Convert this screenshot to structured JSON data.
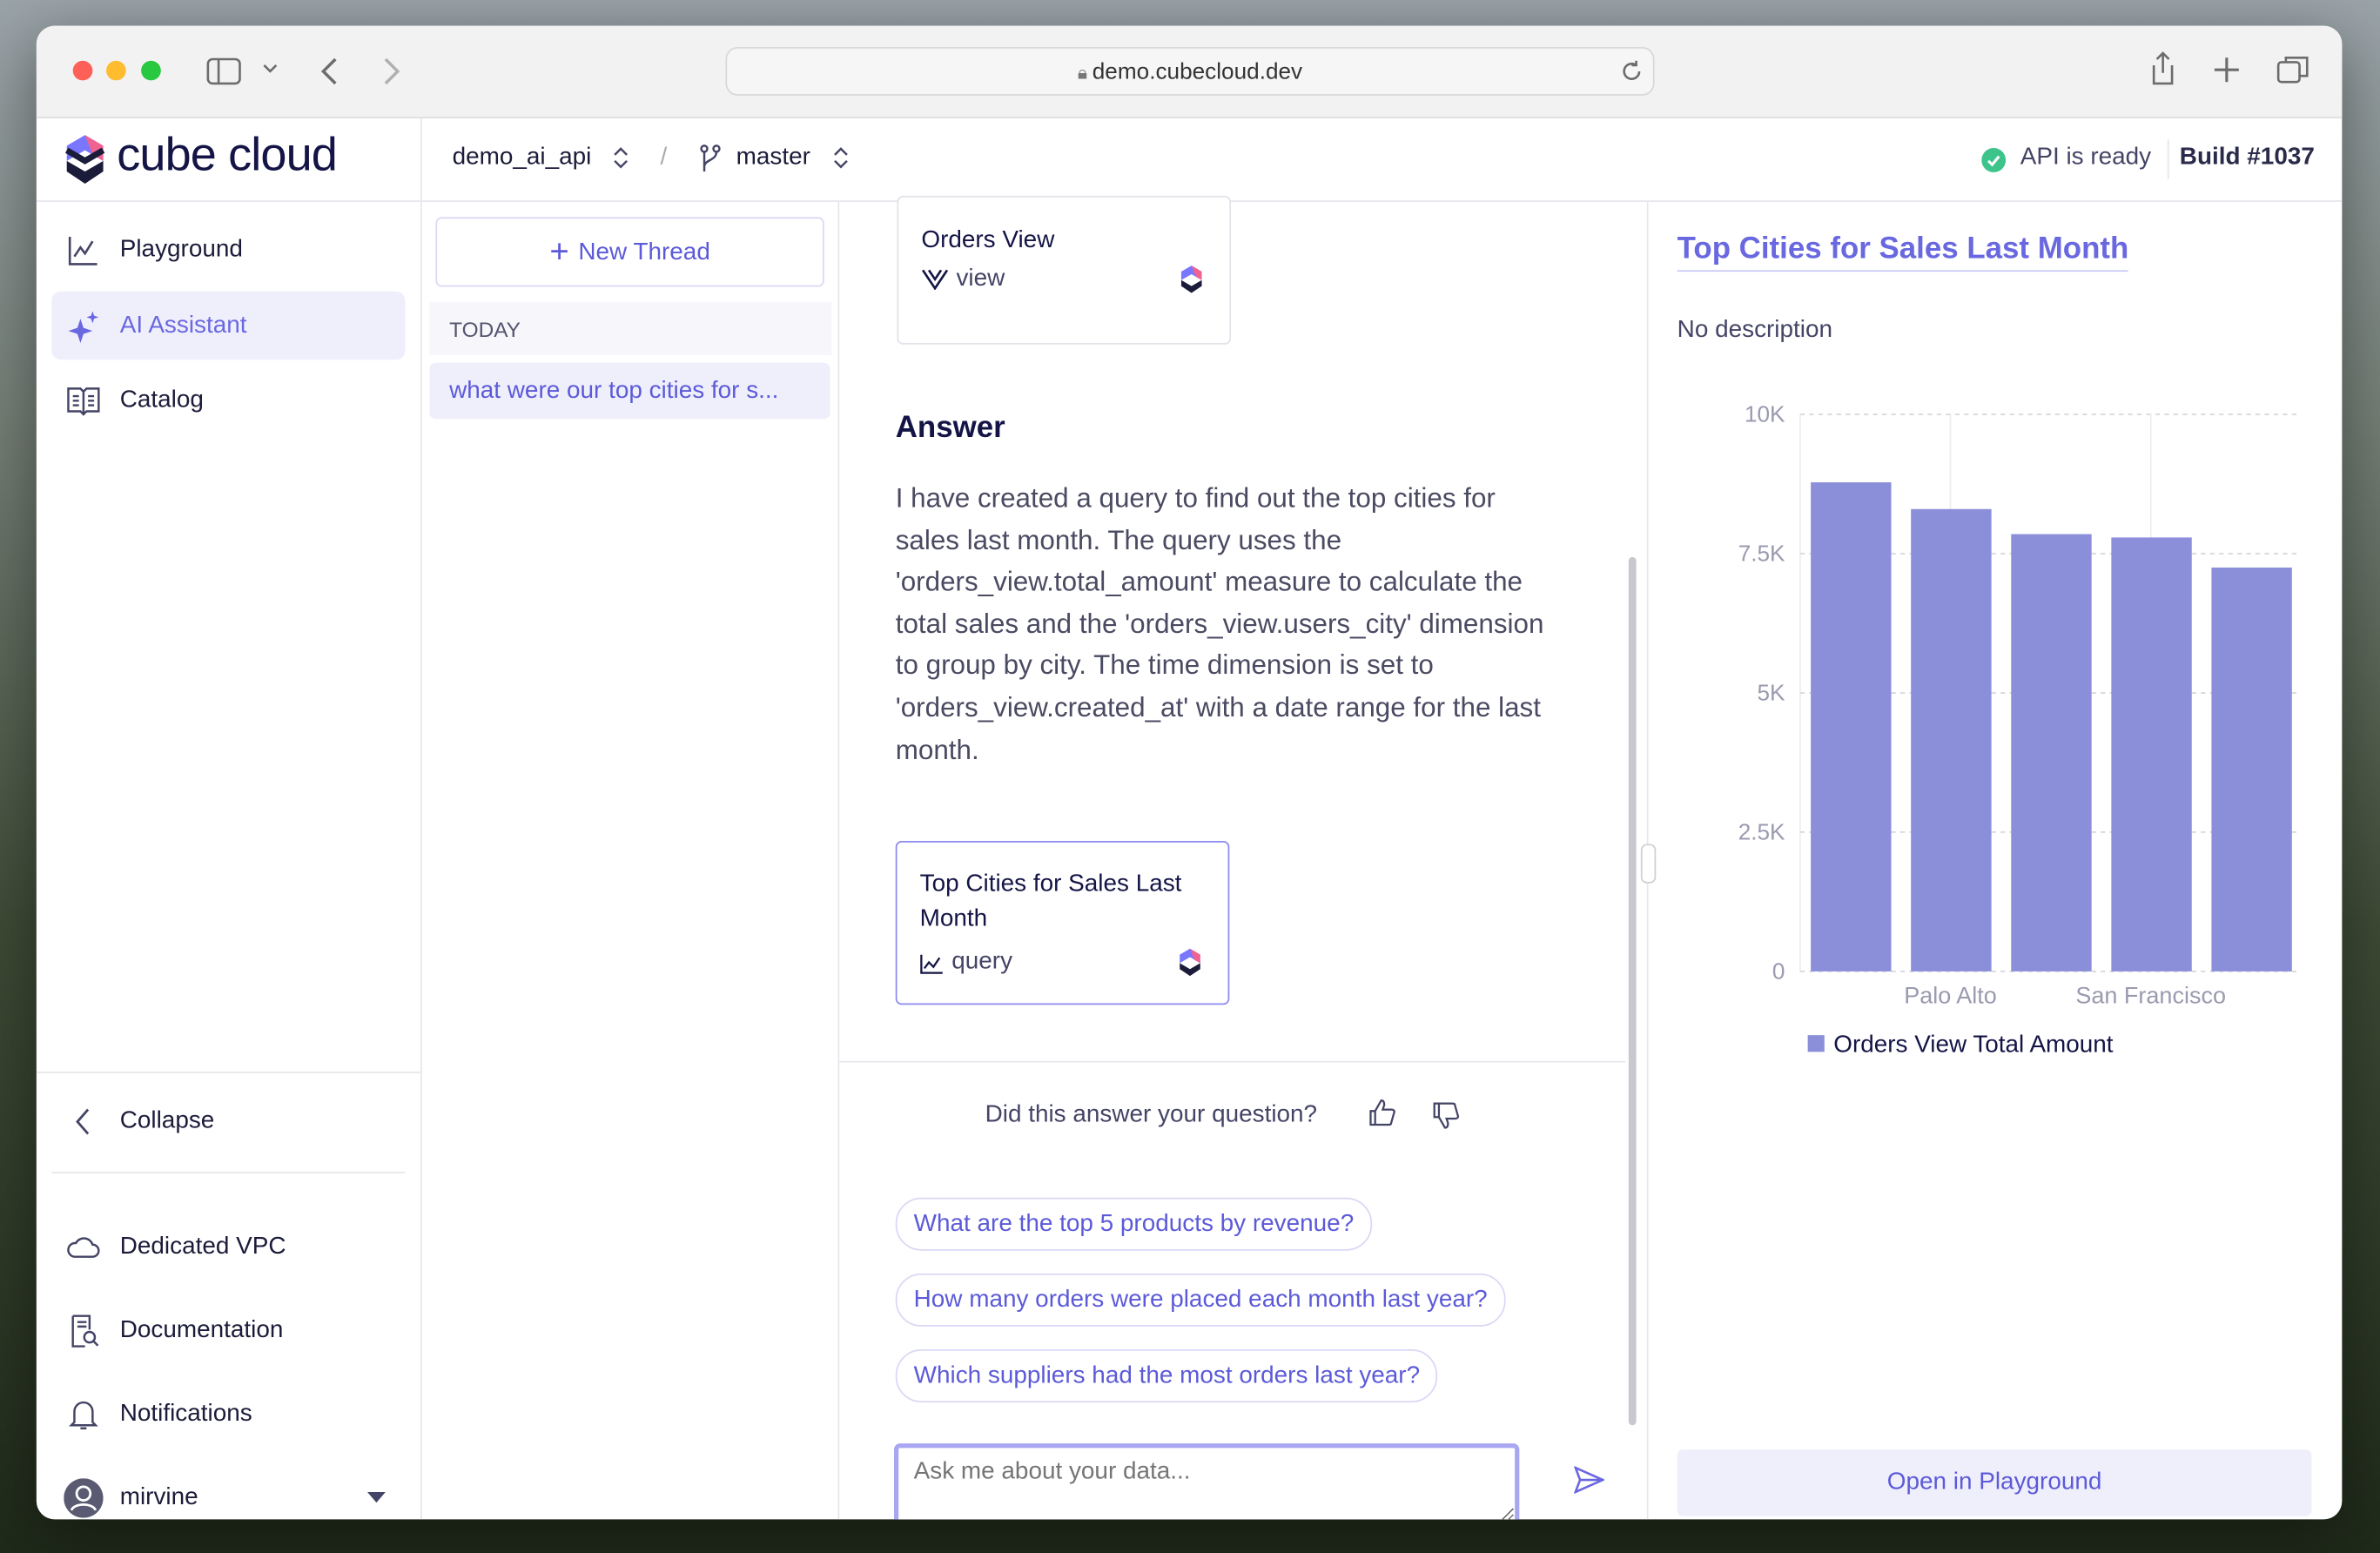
{
  "browser": {
    "url": "demo.cubecloud.dev"
  },
  "header": {
    "logo_text": "cube cloud",
    "project": "demo_ai_api",
    "separator": "/",
    "branch": "master",
    "api_status": "API is ready",
    "build": "Build #1037"
  },
  "sidebar": {
    "items": [
      {
        "label": "Playground",
        "icon": "chart-line-icon"
      },
      {
        "label": "AI Assistant",
        "icon": "sparkles-icon",
        "active": true
      },
      {
        "label": "Catalog",
        "icon": "book-open-icon"
      }
    ],
    "collapse": "Collapse",
    "bottom_items": [
      {
        "label": "Dedicated VPC",
        "icon": "cloud-icon"
      },
      {
        "label": "Documentation",
        "icon": "document-search-icon"
      },
      {
        "label": "Notifications",
        "icon": "bell-icon"
      }
    ],
    "user": "mirvine"
  },
  "threads": {
    "new_thread": "New Thread",
    "group": "TODAY",
    "items": [
      "what were our top cities for s..."
    ]
  },
  "chat": {
    "view_card": {
      "title": "Orders View",
      "type": "view"
    },
    "answer_heading": "Answer",
    "answer_text": "I have created a query to find out the top cities for sales last month. The query uses the 'orders_view.total_amount' measure to calculate the total sales and the 'orders_view.users_city' dimension to group by city. The time dimension is set to 'orders_view.created_at' with a date range for the last month.",
    "query_card": {
      "title": "Top Cities for Sales Last Month",
      "type": "query"
    },
    "feedback": "Did this answer your question?",
    "suggestions": [
      "What are the top 5 products by revenue?",
      "How many orders were placed each month last year?",
      "Which suppliers had the most orders last year?"
    ],
    "input_placeholder": "Ask me about your data..."
  },
  "panel": {
    "title": "Top Cities for Sales Last Month",
    "description": "No description",
    "open_button": "Open in Playground"
  },
  "colors": {
    "accent": "#6a68e0",
    "bar": "#8b8fda",
    "status_ok": "#3cc48a"
  },
  "chart_data": {
    "type": "bar",
    "categories": [
      "",
      "Palo Alto",
      "",
      "San Francisco",
      ""
    ],
    "series": [
      {
        "name": "Orders View Total Amount",
        "values": [
          8780,
          8300,
          7850,
          7790,
          7250
        ]
      }
    ],
    "yticks": [
      "0",
      "2.5K",
      "5K",
      "7.5K",
      "10K"
    ],
    "ylim": [
      0,
      10000
    ],
    "grid": true,
    "legend": "bottom-left"
  }
}
